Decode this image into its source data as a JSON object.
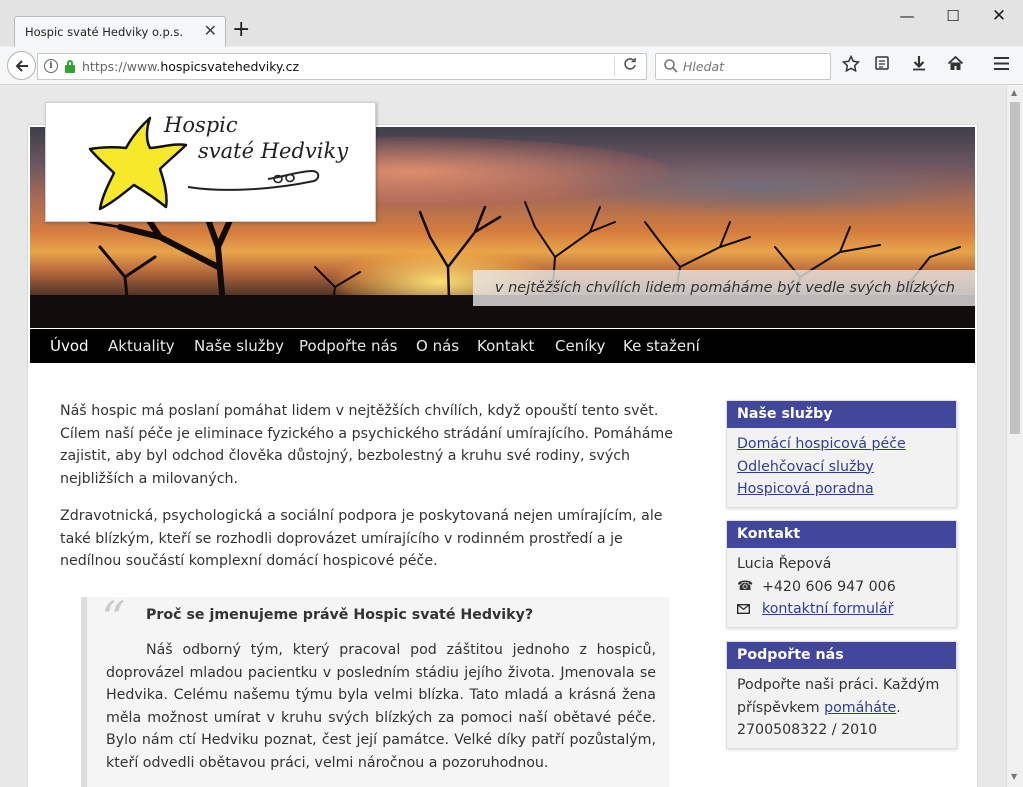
{
  "browser": {
    "tab_title": "Hospic svaté Hedviky o.p.s.",
    "url_prefix": "https://www.",
    "url_domain": "hospicsvatehedviky.cz",
    "search_placeholder": "Hledat"
  },
  "hero": {
    "logo_line1": "Hospic",
    "logo_line2": "svaté Hedviky",
    "tagline": "v nejtěžších chvílích lidem pomáháme být vedle svých blízkých"
  },
  "nav": {
    "items": [
      "Úvod",
      "Aktuality",
      "Naše služby",
      "Podpořte nás",
      "O nás",
      "Kontakt",
      "Ceníky",
      "Ke stažení"
    ]
  },
  "main": {
    "paragraph1": "Náš hospic má poslaní pomáhat lidem v nejtěžších chvílích, když opouští tento svět. Cílem naší péče je eliminace fyzického a psychického strádání umírajícího. Pomáháme zajistit, aby byl odchod člověka důstojný, bezbolestný a kruhu své rodiny, svých nejbližších a milovaných.",
    "paragraph2": "Zdravotnická, psychologická a sociální podpora je poskytovaná nejen umírajícím, ale také blízkým, kteří se rozhodli doprovázet umírajícího v rodinném prostředí a je nedílnou součástí komplexní domácí hospicové péče.",
    "quote_mark": "“",
    "quote_title": "Proč se jmenujeme právě Hospic svaté Hedviky?",
    "quote_body": "Náš odborný tým, který pracoval pod záštitou jednoho z hospiců, doprovázel mladou pacientku v posledním stádiu jejího života. Jmenovala se Hedvika. Celému našemu týmu byla velmi blízka. Tato mladá a krásná žena měla možnost umírat v kruhu svých blízkých za pomoci naší obětavé péče. Bylo nám ctí Hedviku poznat, čest její památce. Velké díky patří pozůstalým, kteří odvedli obětavou práci, velmi náročnou a pozoruhodnou."
  },
  "sidebar": {
    "services": {
      "title": "Naše služby",
      "links": [
        "Domácí hospicová péče",
        "Odlehčovací služby",
        "Hospicová poradna"
      ]
    },
    "contact": {
      "title": "Kontakt",
      "name": "Lucia Řepová",
      "phone": "+420 606 947 006",
      "form_link": "kontaktní formulář"
    },
    "support": {
      "title": "Podpořte nás",
      "text_before": "Podpořte naši práci. Každým příspěvkem ",
      "link": "pomáháte",
      "text_after": ".",
      "account": "2700508322 / 2010"
    }
  },
  "colors": {
    "widget_header": "#43479b",
    "link": "#2f3d93",
    "nav_bg": "#000000",
    "star": "#f6e92c"
  },
  "icons": [
    "back-arrow-icon",
    "info-icon",
    "lock-icon",
    "reload-icon",
    "search-icon",
    "bookmark-star-icon",
    "reading-list-icon",
    "download-icon",
    "home-icon",
    "menu-icon",
    "phone-icon",
    "mail-icon"
  ]
}
